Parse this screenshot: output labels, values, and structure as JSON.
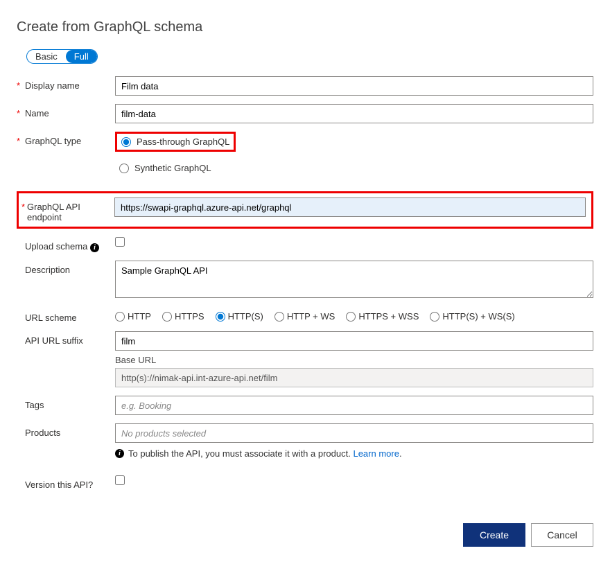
{
  "title": "Create from GraphQL schema",
  "toggle": {
    "basic": "Basic",
    "full": "Full"
  },
  "labels": {
    "display_name": "Display name",
    "name": "Name",
    "graphql_type": "GraphQL type",
    "endpoint": "GraphQL API endpoint",
    "upload_schema": "Upload schema",
    "description": "Description",
    "url_scheme": "URL scheme",
    "api_url_suffix": "API URL suffix",
    "base_url": "Base URL",
    "tags": "Tags",
    "products": "Products",
    "version": "Version this API?"
  },
  "values": {
    "display_name": "Film data",
    "name": "film-data",
    "endpoint": "https://swapi-graphql.azure-api.net/graphql",
    "description": "Sample GraphQL API",
    "api_url_suffix": "film",
    "base_url_value": "http(s)://nimak-api.int-azure-api.net/film"
  },
  "placeholders": {
    "tags": "e.g. Booking",
    "products": "No products selected"
  },
  "graphql_type_options": {
    "pass": "Pass-through GraphQL",
    "synthetic": "Synthetic GraphQL"
  },
  "url_scheme_options": [
    "HTTP",
    "HTTPS",
    "HTTP(S)",
    "HTTP + WS",
    "HTTPS + WSS",
    "HTTP(S) + WS(S)"
  ],
  "url_scheme_selected": 2,
  "hint": {
    "text": "To publish the API, you must associate it with a product.",
    "link": "Learn more"
  },
  "footer": {
    "create": "Create",
    "cancel": "Cancel"
  }
}
